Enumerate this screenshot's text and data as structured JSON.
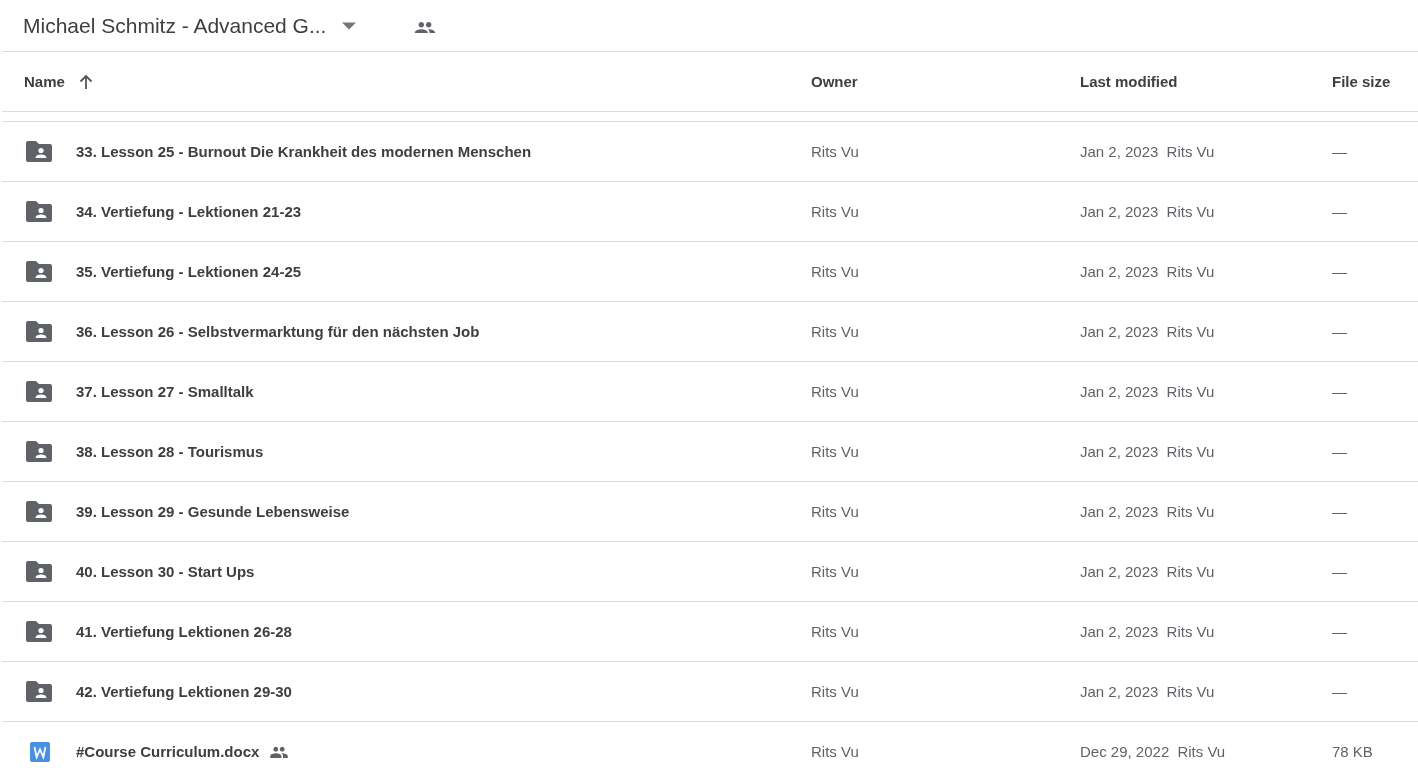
{
  "header": {
    "title": "Michael Schmitz - Advanced G..."
  },
  "table": {
    "columns": [
      {
        "label": "Name",
        "sorted": true
      },
      {
        "label": "Owner",
        "sorted": false
      },
      {
        "label": "Last modified",
        "sorted": false
      },
      {
        "label": "File size",
        "sorted": false
      }
    ],
    "rows": [
      {
        "kind": "folder",
        "name": "33. Lesson 25 - Burnout Die Krankheit des modernen Menschen",
        "shared": false,
        "owner": "Rits Vu",
        "modified": "Jan 2, 2023",
        "modified_by": "Rits Vu",
        "size": "—"
      },
      {
        "kind": "folder",
        "name": "34. Vertiefung - Lektionen 21-23",
        "shared": false,
        "owner": "Rits Vu",
        "modified": "Jan 2, 2023",
        "modified_by": "Rits Vu",
        "size": "—"
      },
      {
        "kind": "folder",
        "name": "35. Vertiefung - Lektionen 24-25",
        "shared": false,
        "owner": "Rits Vu",
        "modified": "Jan 2, 2023",
        "modified_by": "Rits Vu",
        "size": "—"
      },
      {
        "kind": "folder",
        "name": "36. Lesson 26 - Selbstvermarktung für den nächsten Job",
        "shared": false,
        "owner": "Rits Vu",
        "modified": "Jan 2, 2023",
        "modified_by": "Rits Vu",
        "size": "—"
      },
      {
        "kind": "folder",
        "name": "37. Lesson 27 - Smalltalk",
        "shared": false,
        "owner": "Rits Vu",
        "modified": "Jan 2, 2023",
        "modified_by": "Rits Vu",
        "size": "—"
      },
      {
        "kind": "folder",
        "name": "38. Lesson 28 - Tourismus",
        "shared": false,
        "owner": "Rits Vu",
        "modified": "Jan 2, 2023",
        "modified_by": "Rits Vu",
        "size": "—"
      },
      {
        "kind": "folder",
        "name": "39. Lesson 29 - Gesunde Lebensweise",
        "shared": false,
        "owner": "Rits Vu",
        "modified": "Jan 2, 2023",
        "modified_by": "Rits Vu",
        "size": "—"
      },
      {
        "kind": "folder",
        "name": "40. Lesson 30 - Start Ups",
        "shared": false,
        "owner": "Rits Vu",
        "modified": "Jan 2, 2023",
        "modified_by": "Rits Vu",
        "size": "—"
      },
      {
        "kind": "folder",
        "name": "41. Vertiefung Lektionen 26-28",
        "shared": false,
        "owner": "Rits Vu",
        "modified": "Jan 2, 2023",
        "modified_by": "Rits Vu",
        "size": "—"
      },
      {
        "kind": "folder",
        "name": "42. Vertiefung Lektionen 29-30",
        "shared": false,
        "owner": "Rits Vu",
        "modified": "Jan 2, 2023",
        "modified_by": "Rits Vu",
        "size": "—"
      },
      {
        "kind": "word",
        "name": "#Course Curriculum.docx",
        "shared": true,
        "owner": "Rits Vu",
        "modified": "Dec 29, 2022",
        "modified_by": "Rits Vu",
        "size": "78 KB"
      }
    ]
  }
}
